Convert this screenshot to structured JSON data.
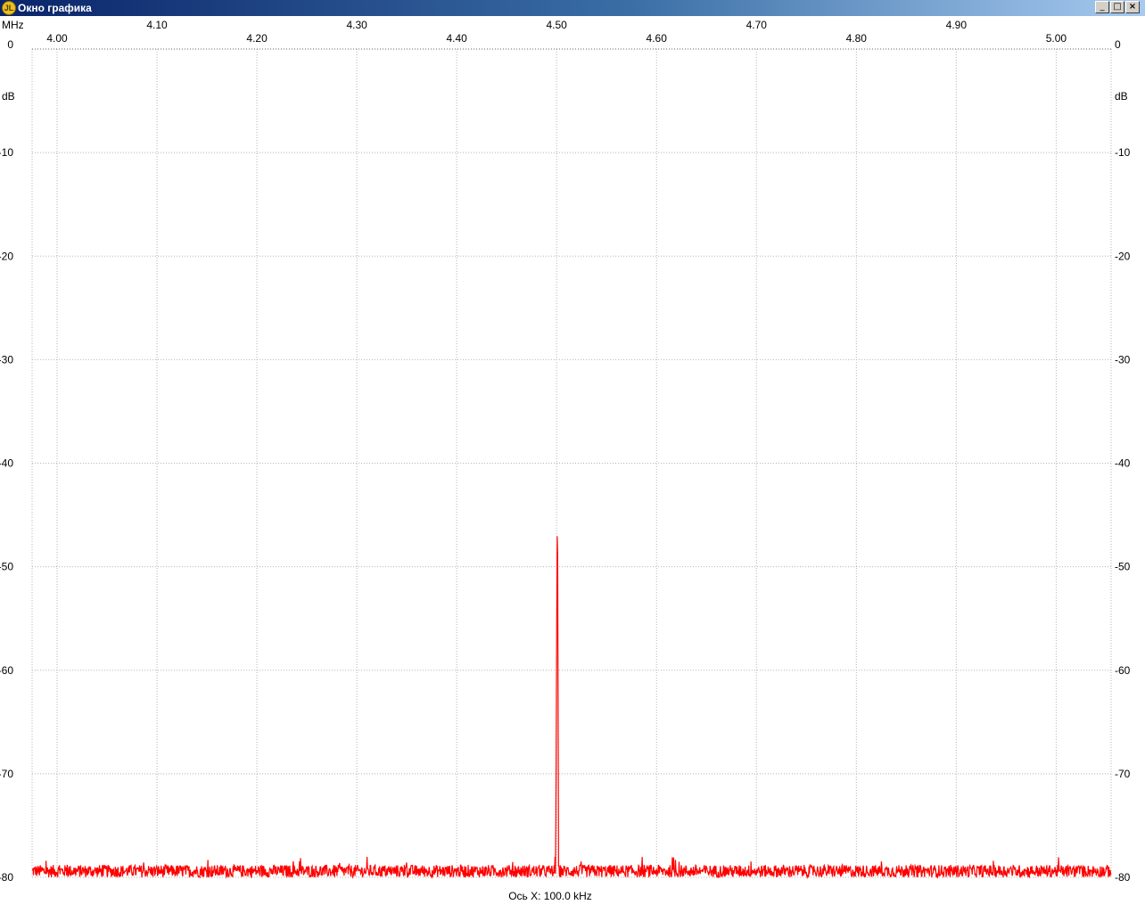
{
  "window": {
    "title": "Окно графика",
    "icon": "app-logo-icon",
    "buttons": {
      "minimize": "_",
      "maximize": "□",
      "close": "×"
    }
  },
  "chart_data": {
    "type": "line",
    "x_unit": "MHz",
    "y_unit": "dB",
    "xlim": [
      3.975,
      5.055
    ],
    "ylim": [
      -80,
      0
    ],
    "x_ticks_top_row": [
      "4.10",
      "4.30",
      "4.50",
      "4.70",
      "4.90"
    ],
    "x_ticks_bottom_row": [
      "4.00",
      "4.20",
      "4.40",
      "4.60",
      "4.80",
      "5.00"
    ],
    "x_tick_values_top_row": [
      4.1,
      4.3,
      4.5,
      4.7,
      4.9
    ],
    "x_tick_values_bottom_row": [
      4.0,
      4.2,
      4.4,
      4.6,
      4.8,
      5.0
    ],
    "y_ticks": [
      "0",
      "-10",
      "-20",
      "-30",
      "-40",
      "-50",
      "-60",
      "-70",
      "-80"
    ],
    "y_tick_values": [
      0,
      -10,
      -20,
      -30,
      -40,
      -50,
      -60,
      -70,
      -80
    ],
    "grid": true,
    "footer": "Ось X: 100.0 kHz",
    "series_color": "#ff0000",
    "grid_color": "#b4b4b4",
    "series": [
      {
        "noise_floor_db": -79.4,
        "noise_spread_db": 0.6,
        "points": [
          {
            "x": 3.975,
            "y": -79.3
          },
          {
            "x": 4.499,
            "y": -79.4
          },
          {
            "x": 4.5,
            "y": -58.4
          },
          {
            "x": 4.5005,
            "y": -47.0
          },
          {
            "x": 4.501,
            "y": -47.3
          },
          {
            "x": 4.502,
            "y": -79.4
          },
          {
            "x": 5.055,
            "y": -79.2
          }
        ]
      }
    ]
  }
}
